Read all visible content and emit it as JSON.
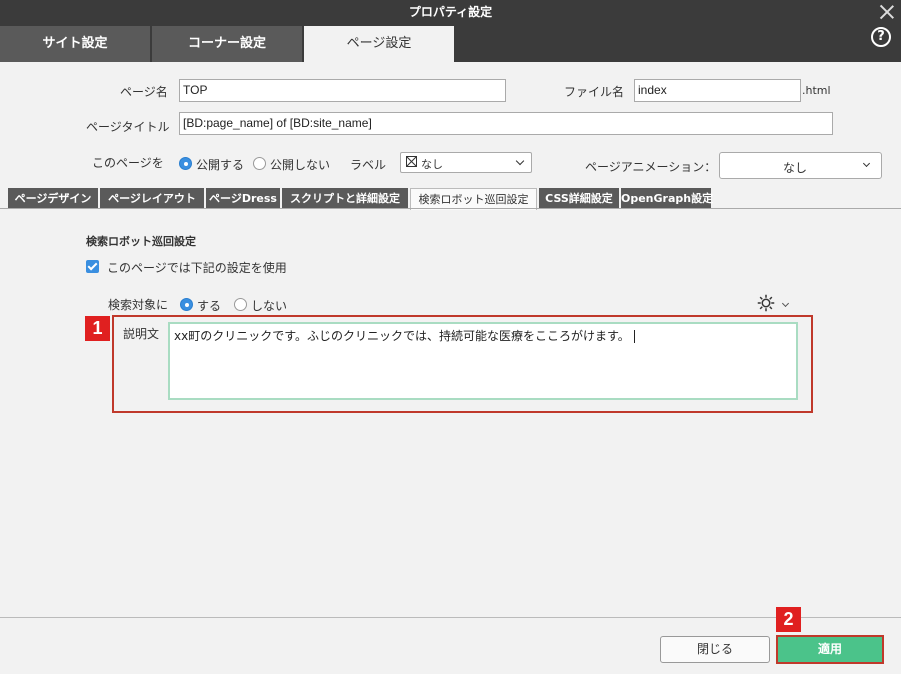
{
  "window": {
    "title": "プロパティ設定"
  },
  "main_tabs": [
    {
      "label": "サイト設定"
    },
    {
      "label": "コーナー設定"
    },
    {
      "label": "ページ設定"
    }
  ],
  "help_label": "?",
  "form": {
    "page_name_label": "ページ名",
    "page_name_value": "TOP",
    "file_name_label": "ファイル名",
    "file_name_value": "index",
    "file_ext": ".html",
    "page_title_label": "ページタイトル",
    "page_title_value": "[BD:page_name] of [BD:site_name]",
    "publish_label": "このページを",
    "publish_yes": "公開する",
    "publish_no": "公開しない",
    "label_label": "ラベル",
    "label_value": "なし",
    "anim_label": "ページアニメーション：",
    "anim_value": "なし"
  },
  "sub_tabs": [
    {
      "label": "ページデザイン"
    },
    {
      "label": "ページレイアウト"
    },
    {
      "label": "ページDress"
    },
    {
      "label": "スクリプトと詳細設定"
    },
    {
      "label": "検索ロボット巡回設定"
    },
    {
      "label": "CSS詳細設定"
    },
    {
      "label": "OpenGraph設定"
    }
  ],
  "robot": {
    "section_title": "検索ロボット巡回設定",
    "use_settings_label": "このページでは下記の設定を使用",
    "target_label": "検索対象に",
    "target_yes": "する",
    "target_no": "しない",
    "desc_label": "説明文",
    "desc_value": "xx町のクリニックです。ふじのクリニックでは、持続可能な医療をこころがけます。"
  },
  "badges": {
    "one": "1",
    "two": "2"
  },
  "footer": {
    "close_label": "閉じる",
    "apply_label": "適用"
  },
  "colors": {
    "accent_green": "#4bc38a",
    "highlight_red": "#c0392b",
    "radio_blue": "#3a8fe0"
  }
}
